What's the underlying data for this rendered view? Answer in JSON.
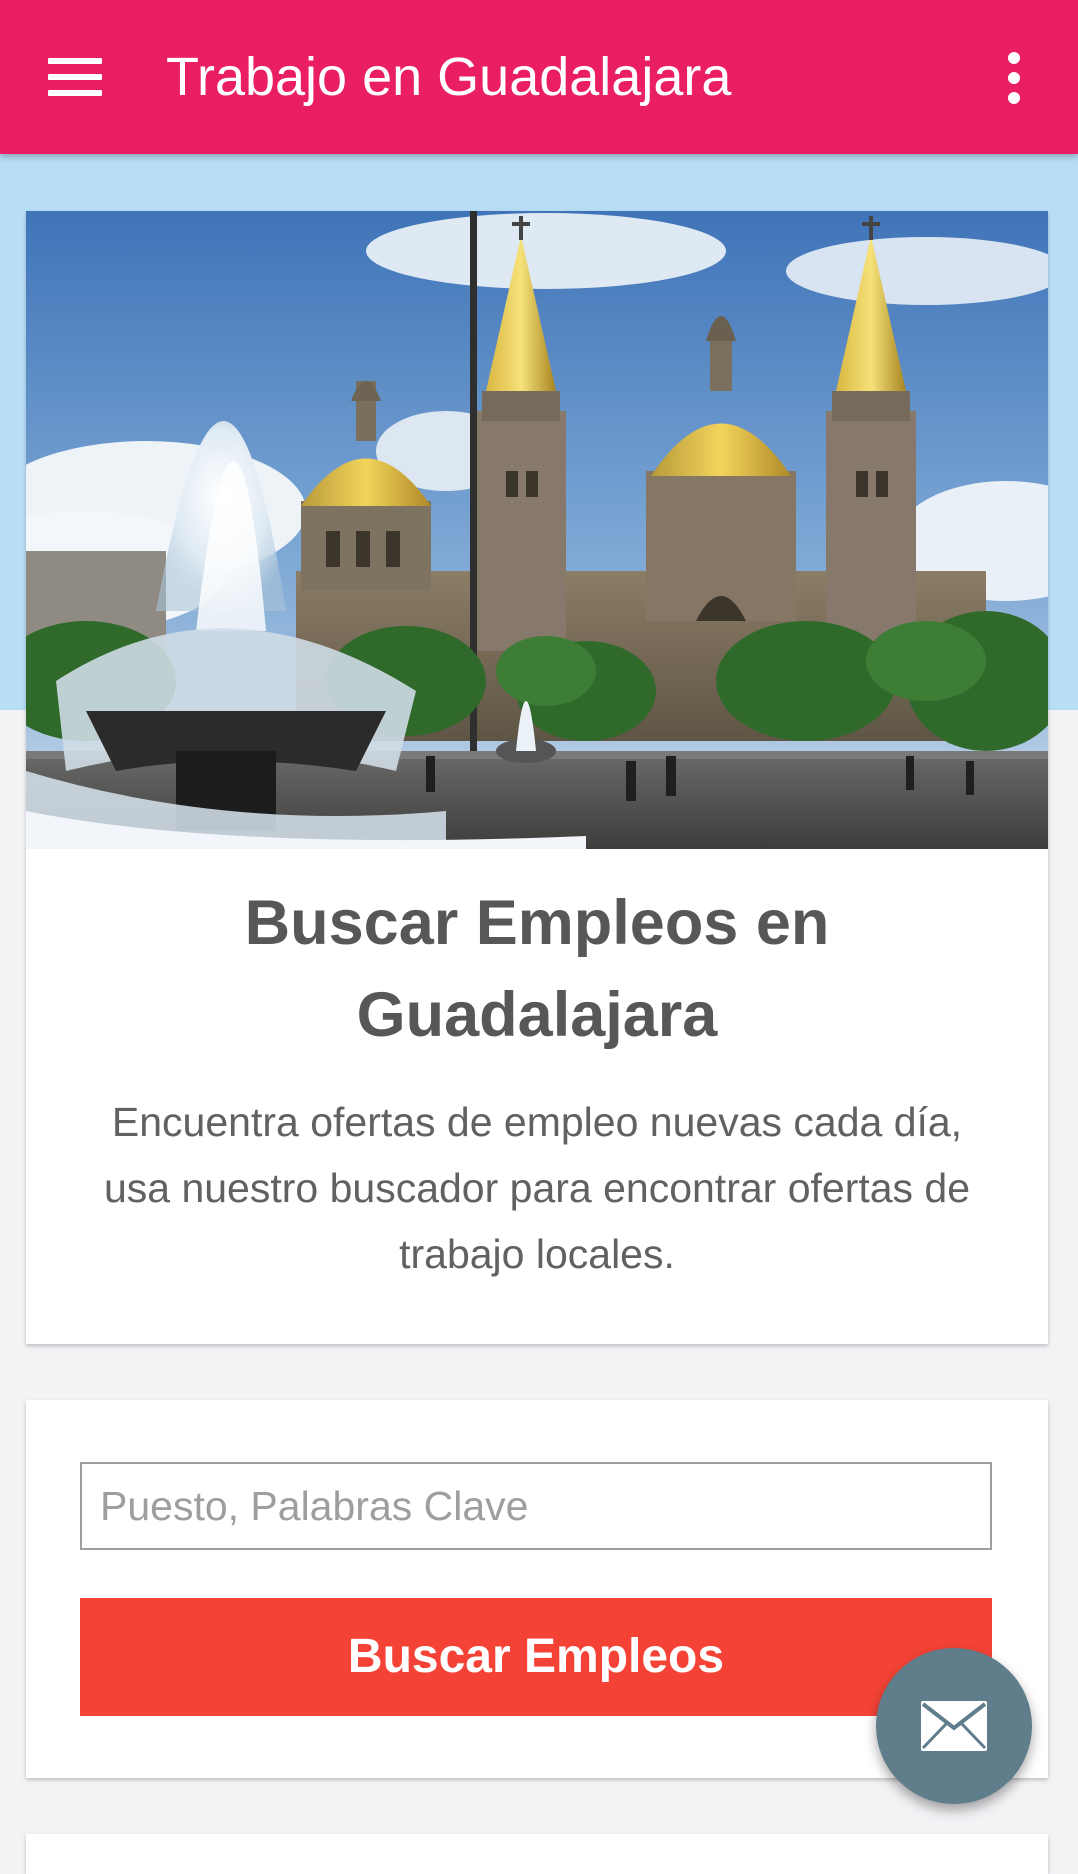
{
  "appbar": {
    "title": "Trabajo en Guadalajara",
    "menu_icon": "hamburger-menu-icon",
    "overflow_icon": "more-vert-icon"
  },
  "colors": {
    "appbar": "#e91e63",
    "hero_background": "#b8def6",
    "search_button": "#f44336",
    "fab": "#607d8b"
  },
  "intro_card": {
    "image_alt": "Catedral de Guadalajara con fuente",
    "heading": "Buscar Empleos en Guadalajara",
    "description": "Encuentra ofertas de empleo nuevas cada día, usa nuestro buscador para encontrar ofertas de trabajo locales."
  },
  "search_card": {
    "input_placeholder": "Puesto, Palabras Clave",
    "input_value": "",
    "button_label": "Buscar Empleos"
  },
  "fab": {
    "icon": "mail-icon"
  }
}
